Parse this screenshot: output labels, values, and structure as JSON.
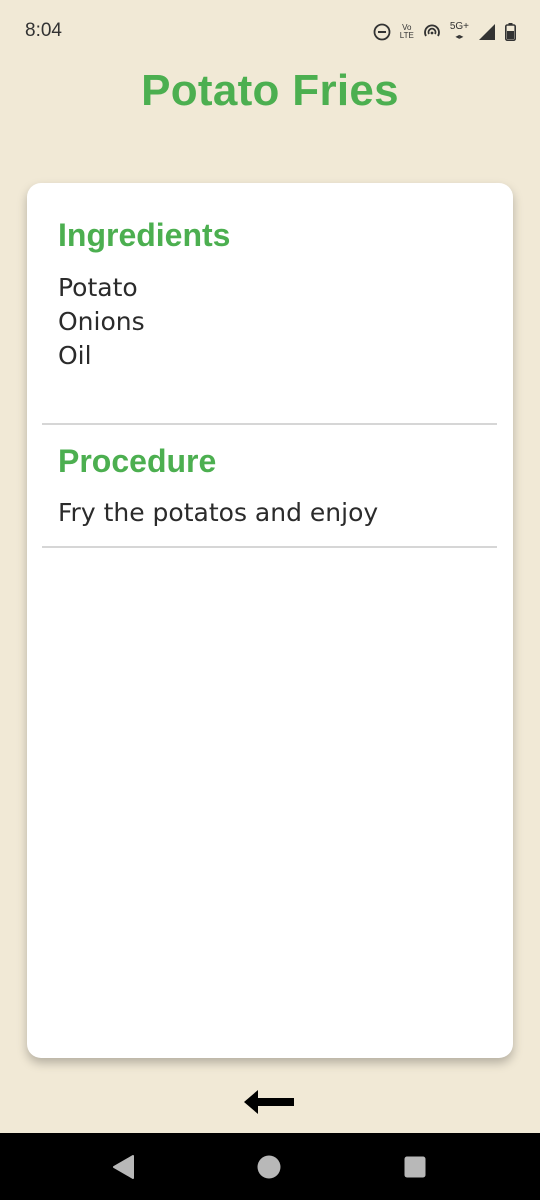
{
  "status_bar": {
    "time": "8:04",
    "volte_top": "Vo",
    "volte_bottom": "LTE",
    "network": "5G+"
  },
  "page": {
    "title": "Potato Fries"
  },
  "recipe": {
    "ingredients_heading": "Ingredients",
    "ingredients": [
      "Potato",
      "Onions",
      "Oil"
    ],
    "procedure_heading": "Procedure",
    "procedure": "Fry the potatos and enjoy"
  },
  "colors": {
    "accent": "#4caf50",
    "background": "#f1e9d6",
    "card": "#ffffff"
  },
  "icons": {
    "back": "back-arrow-icon",
    "nav_back": "triangle-back-icon",
    "nav_home": "circle-home-icon",
    "nav_recents": "square-recents-icon"
  }
}
